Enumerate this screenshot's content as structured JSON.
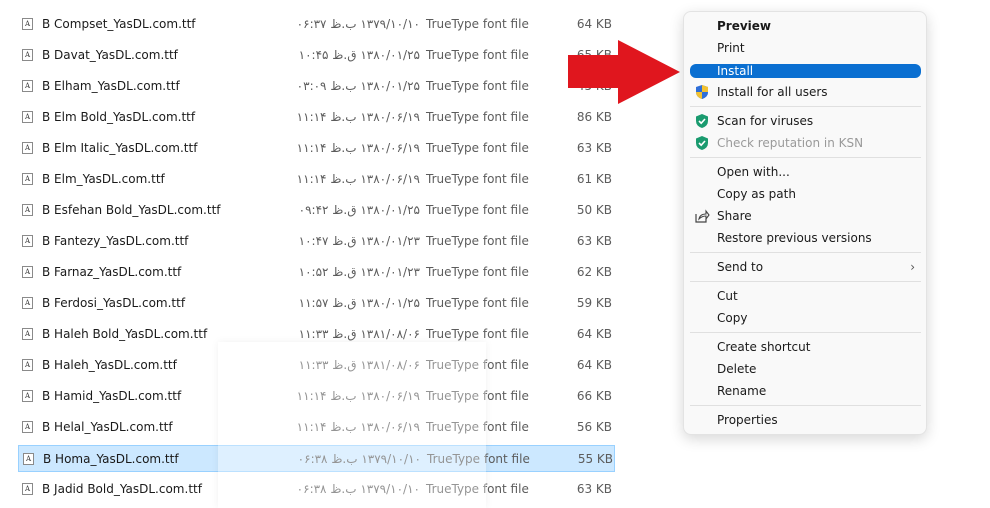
{
  "files": [
    {
      "name": "B Compset_YasDL.com.ttf",
      "date": "۱۳۷۹/۱۰/۱۰ ب.ظ ۰۶:۳۷",
      "type": "TrueType font file",
      "size": "64 KB"
    },
    {
      "name": "B Davat_YasDL.com.ttf",
      "date": "۱۳۸۰/۰۱/۲۵ ق.ظ ۱۰:۴۵",
      "type": "TrueType font file",
      "size": "65 KB"
    },
    {
      "name": "B Elham_YasDL.com.ttf",
      "date": "۱۳۸۰/۰۱/۲۵ ب.ظ ۰۳:۰۹",
      "type": "TrueType font file",
      "size": "45 KB"
    },
    {
      "name": "B Elm Bold_YasDL.com.ttf",
      "date": "۱۳۸۰/۰۶/۱۹ ب.ظ ۱۱:۱۴",
      "type": "TrueType font file",
      "size": "86 KB"
    },
    {
      "name": "B Elm Italic_YasDL.com.ttf",
      "date": "۱۳۸۰/۰۶/۱۹ ب.ظ ۱۱:۱۴",
      "type": "TrueType font file",
      "size": "63 KB"
    },
    {
      "name": "B Elm_YasDL.com.ttf",
      "date": "۱۳۸۰/۰۶/۱۹ ب.ظ ۱۱:۱۴",
      "type": "TrueType font file",
      "size": "61 KB"
    },
    {
      "name": "B Esfehan Bold_YasDL.com.ttf",
      "date": "۱۳۸۰/۰۱/۲۵ ق.ظ ۰۹:۴۲",
      "type": "TrueType font file",
      "size": "50 KB"
    },
    {
      "name": "B Fantezy_YasDL.com.ttf",
      "date": "۱۳۸۰/۰۱/۲۳ ق.ظ ۱۰:۴۷",
      "type": "TrueType font file",
      "size": "63 KB"
    },
    {
      "name": "B Farnaz_YasDL.com.ttf",
      "date": "۱۳۸۰/۰۱/۲۳ ق.ظ ۱۰:۵۲",
      "type": "TrueType font file",
      "size": "62 KB"
    },
    {
      "name": "B Ferdosi_YasDL.com.ttf",
      "date": "۱۳۸۰/۰۱/۲۵ ق.ظ ۱۱:۵۷",
      "type": "TrueType font file",
      "size": "59 KB"
    },
    {
      "name": "B Haleh Bold_YasDL.com.ttf",
      "date": "۱۳۸۱/۰۸/۰۶ ق.ظ ۱۱:۳۳",
      "type": "TrueType font file",
      "size": "64 KB"
    },
    {
      "name": "B Haleh_YasDL.com.ttf",
      "date": "۱۳۸۱/۰۸/۰۶ ق.ظ ۱۱:۳۳",
      "type": "TrueType font file",
      "size": "64 KB"
    },
    {
      "name": "B Hamid_YasDL.com.ttf",
      "date": "۱۳۸۰/۰۶/۱۹ ب.ظ ۱۱:۱۴",
      "type": "TrueType font file",
      "size": "66 KB"
    },
    {
      "name": "B Helal_YasDL.com.ttf",
      "date": "۱۳۸۰/۰۶/۱۹ ب.ظ ۱۱:۱۴",
      "type": "TrueType font file",
      "size": "56 KB"
    },
    {
      "name": "B Homa_YasDL.com.ttf",
      "date": "۱۳۷۹/۱۰/۱۰ ب.ظ ۰۶:۳۸",
      "type": "TrueType font file",
      "size": "55 KB",
      "selected": true
    },
    {
      "name": "B Jadid Bold_YasDL.com.ttf",
      "date": "۱۳۷۹/۱۰/۱۰ ب.ظ ۰۶:۳۸",
      "type": "TrueType font file",
      "size": "63 KB"
    }
  ],
  "file_icon_glyph": "A",
  "context_menu": {
    "items": [
      {
        "label": "Preview",
        "bold": true
      },
      {
        "label": "Print"
      },
      {
        "label": "Install",
        "highlight": true
      },
      {
        "label": "Install for all users",
        "icon": "uac-shield-icon"
      },
      {
        "sep": true
      },
      {
        "label": "Scan for viruses",
        "icon": "kaspersky-shield-icon"
      },
      {
        "label": "Check reputation in KSN",
        "icon": "kaspersky-shield-icon",
        "disabled": true
      },
      {
        "sep": true
      },
      {
        "label": "Open with..."
      },
      {
        "label": "Copy as path"
      },
      {
        "label": "Share",
        "icon": "share-icon"
      },
      {
        "label": "Restore previous versions"
      },
      {
        "sep": true
      },
      {
        "label": "Send to",
        "submenu": true
      },
      {
        "sep": true
      },
      {
        "label": "Cut"
      },
      {
        "label": "Copy"
      },
      {
        "sep": true
      },
      {
        "label": "Create shortcut"
      },
      {
        "label": "Delete"
      },
      {
        "label": "Rename"
      },
      {
        "sep": true
      },
      {
        "label": "Properties"
      }
    ],
    "submenu_glyph": "›"
  },
  "colors": {
    "selection_bg": "#cce8ff",
    "menu_highlight": "#0a6fd1",
    "arrow": "#e0161e",
    "kaspersky_green": "#1a9b6f"
  }
}
